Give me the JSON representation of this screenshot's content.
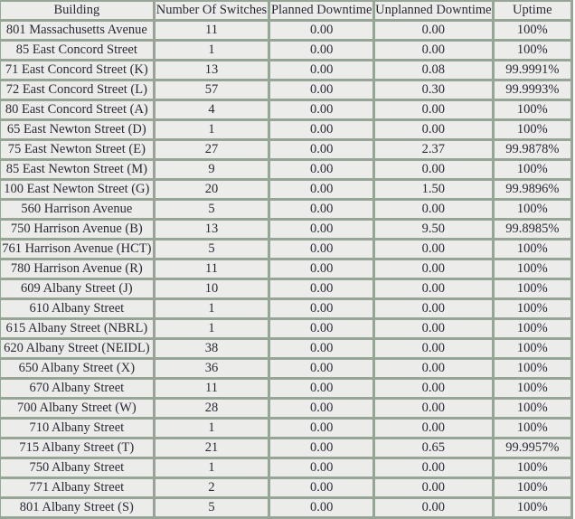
{
  "table": {
    "headers": [
      "Building",
      "Number Of Switches",
      "Planned Downtime",
      "Unplanned Downtime",
      "Uptime"
    ],
    "status_colors": {
      "normal": "#ececeb",
      "degraded": "#f0b9b1",
      "notice": "#f3ebe2",
      "border": "#97a597"
    },
    "rows": [
      {
        "building": "801 Massachusetts Avenue",
        "switches": "11",
        "planned": "0.00",
        "unplanned": "0.00",
        "uptime": "100%",
        "status": "normal"
      },
      {
        "building": "85 East Concord Street",
        "switches": "1",
        "planned": "0.00",
        "unplanned": "0.00",
        "uptime": "100%",
        "status": "normal"
      },
      {
        "building": "71 East Concord Street (K)",
        "switches": "13",
        "planned": "0.00",
        "unplanned": "0.08",
        "uptime": "99.9991%",
        "status": "degraded"
      },
      {
        "building": "72 East Concord Street (L)",
        "switches": "57",
        "planned": "0.00",
        "unplanned": "0.30",
        "uptime": "99.9993%",
        "status": "degraded"
      },
      {
        "building": "80 East Concord Street (A)",
        "switches": "4",
        "planned": "0.00",
        "unplanned": "0.00",
        "uptime": "100%",
        "status": "normal"
      },
      {
        "building": "65 East Newton Street (D)",
        "switches": "1",
        "planned": "0.00",
        "unplanned": "0.00",
        "uptime": "100%",
        "status": "normal"
      },
      {
        "building": "75 East Newton Street (E)",
        "switches": "27",
        "planned": "0.00",
        "unplanned": "2.37",
        "uptime": "99.9878%",
        "status": "degraded"
      },
      {
        "building": "85 East Newton Street (M)",
        "switches": "9",
        "planned": "0.00",
        "unplanned": "0.00",
        "uptime": "100%",
        "status": "normal"
      },
      {
        "building": "100 East Newton Street (G)",
        "switches": "20",
        "planned": "0.00",
        "unplanned": "1.50",
        "uptime": "99.9896%",
        "status": "degraded"
      },
      {
        "building": "560 Harrison Avenue",
        "switches": "5",
        "planned": "0.00",
        "unplanned": "0.00",
        "uptime": "100%",
        "status": "normal"
      },
      {
        "building": "750 Harrison Avenue (B)",
        "switches": "13",
        "planned": "0.00",
        "unplanned": "9.50",
        "uptime": "99.8985%",
        "status": "degraded"
      },
      {
        "building": "761 Harrison Avenue (HCT)",
        "switches": "5",
        "planned": "0.00",
        "unplanned": "0.00",
        "uptime": "100%",
        "status": "normal"
      },
      {
        "building": "780 Harrison Avenue (R)",
        "switches": "11",
        "planned": "0.00",
        "unplanned": "0.00",
        "uptime": "100%",
        "status": "normal"
      },
      {
        "building": "609 Albany Street (J)",
        "switches": "10",
        "planned": "0.00",
        "unplanned": "0.00",
        "uptime": "100%",
        "status": "normal"
      },
      {
        "building": "610 Albany Street",
        "switches": "1",
        "planned": "0.00",
        "unplanned": "0.00",
        "uptime": "100%",
        "status": "normal"
      },
      {
        "building": "615 Albany Street (NBRL)",
        "switches": "1",
        "planned": "0.00",
        "unplanned": "0.00",
        "uptime": "100%",
        "status": "normal"
      },
      {
        "building": "620 Albany Street (NEIDL)",
        "switches": "38",
        "planned": "0.00",
        "unplanned": "0.00",
        "uptime": "100%",
        "status": "notice"
      },
      {
        "building": "650 Albany Street (X)",
        "switches": "36",
        "planned": "0.00",
        "unplanned": "0.00",
        "uptime": "100%",
        "status": "normal"
      },
      {
        "building": "670 Albany Street",
        "switches": "11",
        "planned": "0.00",
        "unplanned": "0.00",
        "uptime": "100%",
        "status": "normal"
      },
      {
        "building": "700 Albany Street (W)",
        "switches": "28",
        "planned": "0.00",
        "unplanned": "0.00",
        "uptime": "100%",
        "status": "normal"
      },
      {
        "building": "710 Albany Street",
        "switches": "1",
        "planned": "0.00",
        "unplanned": "0.00",
        "uptime": "100%",
        "status": "normal"
      },
      {
        "building": "715 Albany Street (T)",
        "switches": "21",
        "planned": "0.00",
        "unplanned": "0.65",
        "uptime": "99.9957%",
        "status": "degraded"
      },
      {
        "building": "750 Albany Street",
        "switches": "1",
        "planned": "0.00",
        "unplanned": "0.00",
        "uptime": "100%",
        "status": "normal"
      },
      {
        "building": "771 Albany Street",
        "switches": "2",
        "planned": "0.00",
        "unplanned": "0.00",
        "uptime": "100%",
        "status": "normal"
      },
      {
        "building": "801 Albany Street (S)",
        "switches": "5",
        "planned": "0.00",
        "unplanned": "0.00",
        "uptime": "100%",
        "status": "normal"
      }
    ]
  }
}
